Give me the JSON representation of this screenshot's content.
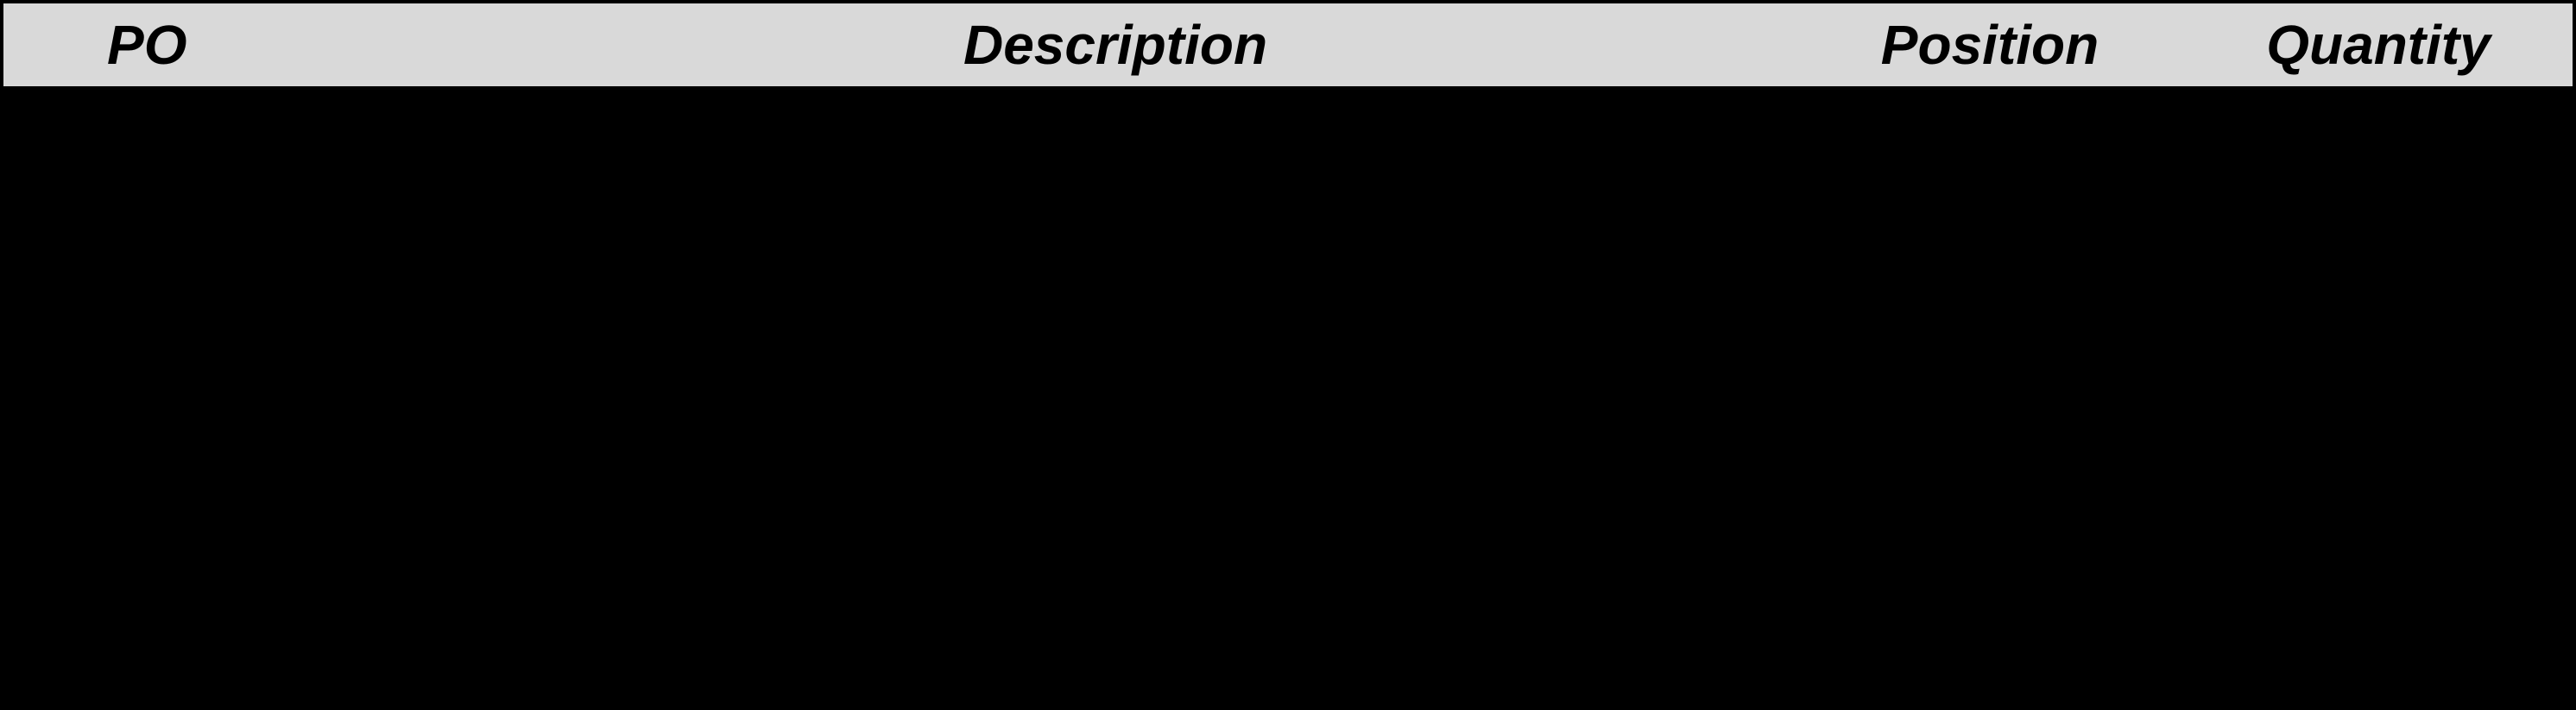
{
  "table": {
    "headers": {
      "po": "PO",
      "description": "Description",
      "position": "Position",
      "quantity": "Quantity"
    },
    "rows": []
  }
}
